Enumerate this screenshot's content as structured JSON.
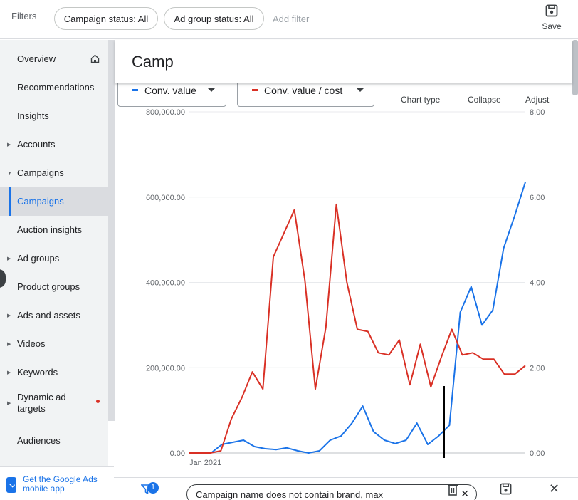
{
  "filterbar": {
    "label": "Filters",
    "chips": [
      "Campaign status: All",
      "Ad group status: All"
    ],
    "add_filter": "Add filter",
    "save_label": "Save"
  },
  "sidebar": {
    "items": [
      {
        "label": "Overview"
      },
      {
        "label": "Recommendations"
      },
      {
        "label": "Insights"
      },
      {
        "label": "Accounts",
        "expandable": true
      },
      {
        "label": "Campaigns",
        "expanded": true
      },
      {
        "label": "Campaigns",
        "active": true
      },
      {
        "label": "Auction insights"
      },
      {
        "label": "Ad groups",
        "expandable": true
      },
      {
        "label": "Product groups"
      },
      {
        "label": "Ads and assets",
        "expandable": true
      },
      {
        "label": "Videos",
        "expandable": true
      },
      {
        "label": "Keywords",
        "expandable": true
      },
      {
        "label": "Dynamic ad targets",
        "expandable": true,
        "dot": true
      },
      {
        "label": "Audiences"
      }
    ],
    "mobile_app": "Get the Google Ads mobile app"
  },
  "header": {
    "title": "Camp"
  },
  "chart_controls": {
    "metric1": "Conv. value",
    "metric2": "Conv. value / cost",
    "chart_type": "Chart type",
    "collapse": "Collapse",
    "adjust": "Adjust"
  },
  "colors": {
    "accent": "#1a73e8",
    "series1": "#1a73e8",
    "series2": "#d93025"
  },
  "chart_data": {
    "type": "line",
    "x_label": "Jan 2021",
    "left_axis": {
      "ticks": [
        "0.00",
        "200,000.00",
        "400,000.00",
        "600,000.00",
        "800,000.00"
      ],
      "values": [
        0,
        200000,
        400000,
        600000,
        800000
      ],
      "ylim": [
        0,
        800000
      ]
    },
    "right_axis": {
      "ticks": [
        "0.00",
        "2.00",
        "4.00",
        "6.00",
        "8.00"
      ],
      "values": [
        0,
        2,
        4,
        6,
        8
      ],
      "ylim": [
        0,
        8
      ]
    },
    "grid": true,
    "series": [
      {
        "name": "Conv. value",
        "axis": "left",
        "values": [
          0,
          0,
          0,
          20000,
          25000,
          30000,
          15000,
          10000,
          8000,
          12000,
          5000,
          0,
          5000,
          30000,
          40000,
          70000,
          110000,
          50000,
          30000,
          22000,
          30000,
          70000,
          20000,
          40000,
          65000,
          330000,
          390000,
          300000,
          335000,
          480000,
          555000,
          635000
        ]
      },
      {
        "name": "Conv. value / cost",
        "axis": "left",
        "values": [
          0,
          0,
          0,
          5000,
          80000,
          130000,
          190000,
          150000,
          460000,
          515000,
          570000,
          405000,
          150000,
          295000,
          583000,
          400000,
          290000,
          285000,
          235000,
          230000,
          265000,
          160000,
          255000,
          155000,
          225000,
          290000,
          230000,
          235000,
          220000,
          220000,
          185000,
          185000,
          205000
        ]
      }
    ]
  },
  "bottom_bar": {
    "badge": "1",
    "filter_text": "Campaign name does not contain brand, max"
  }
}
